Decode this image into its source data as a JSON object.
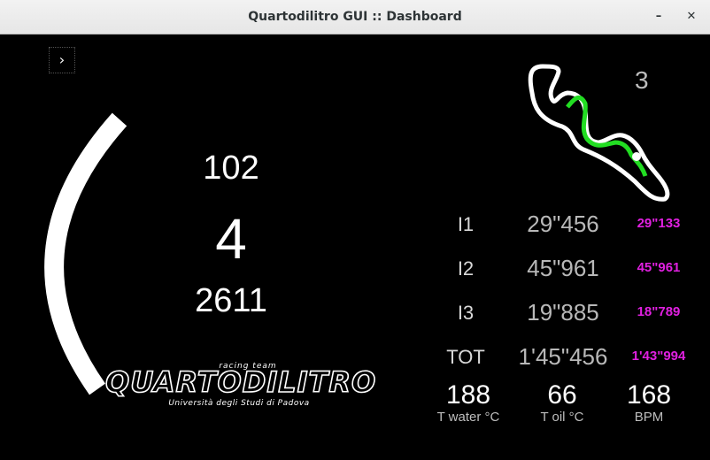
{
  "window": {
    "title": "Quartodilitro GUI :: Dashboard",
    "minimize_glyph": "–",
    "close_glyph": "✕"
  },
  "menu": {
    "icon": "chevron-right-icon",
    "glyph": "›"
  },
  "telemetry": {
    "speed": "102",
    "gear": "4",
    "rpm": "2611",
    "rpm_bar_fraction": 0.35
  },
  "track": {
    "lap": "3",
    "highlight_color": "#22dd22"
  },
  "laps": [
    {
      "label": "I1",
      "time": "29\"456",
      "best": "29\"133"
    },
    {
      "label": "I2",
      "time": "45\"961",
      "best": "45\"961"
    },
    {
      "label": "I3",
      "time": "19\"885",
      "best": "18\"789"
    },
    {
      "label": "TOT",
      "time": "1'45\"456",
      "best": "1'43\"994"
    }
  ],
  "sensors": [
    {
      "value": "188",
      "caption": "T water °C"
    },
    {
      "value": "66",
      "caption": "T oil °C"
    },
    {
      "value": "168",
      "caption": "BPM"
    }
  ],
  "logo": {
    "tagline": "racing team",
    "name": "QUARTODILITRO",
    "university": "Università degli Studi di Padova"
  },
  "colors": {
    "best_time": "#e020e0",
    "background": "#000000"
  }
}
